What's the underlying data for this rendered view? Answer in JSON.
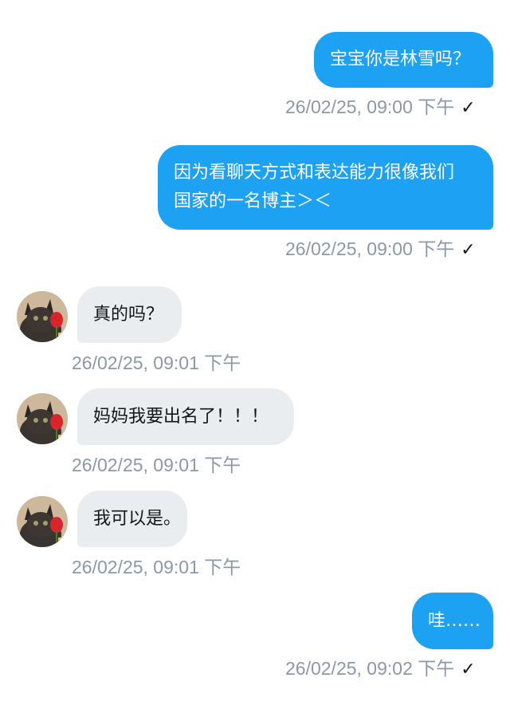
{
  "messages": [
    {
      "direction": "out",
      "text": "宝宝你是林雪吗？",
      "time": "26/02/25, 09:00 下午",
      "read_icon": "checkmark-icon"
    },
    {
      "direction": "out",
      "text_lines": [
        "因为看聊天方式和表达能力很像我们",
        "国家的一名博主＞＜"
      ],
      "time": "26/02/25, 09:00 下午",
      "read_icon": "checkmark-icon"
    },
    {
      "direction": "in",
      "text": "真的吗？",
      "time": "26/02/25, 09:01 下午"
    },
    {
      "direction": "in",
      "text": "妈妈我要出名了！！！",
      "time": "26/02/25, 09:01 下午"
    },
    {
      "direction": "in",
      "text": "我可以是。",
      "time": "26/02/25, 09:01 下午"
    },
    {
      "direction": "out",
      "text": "哇……",
      "time": "26/02/25, 09:02 下午",
      "read_icon": "checkmark-icon"
    }
  ],
  "avatar_icon": "cat-with-rose-avatar",
  "colors": {
    "outgoing_bubble": "#1da1f2",
    "incoming_bubble": "#e9edf0",
    "timestamp": "#8b98a5"
  }
}
